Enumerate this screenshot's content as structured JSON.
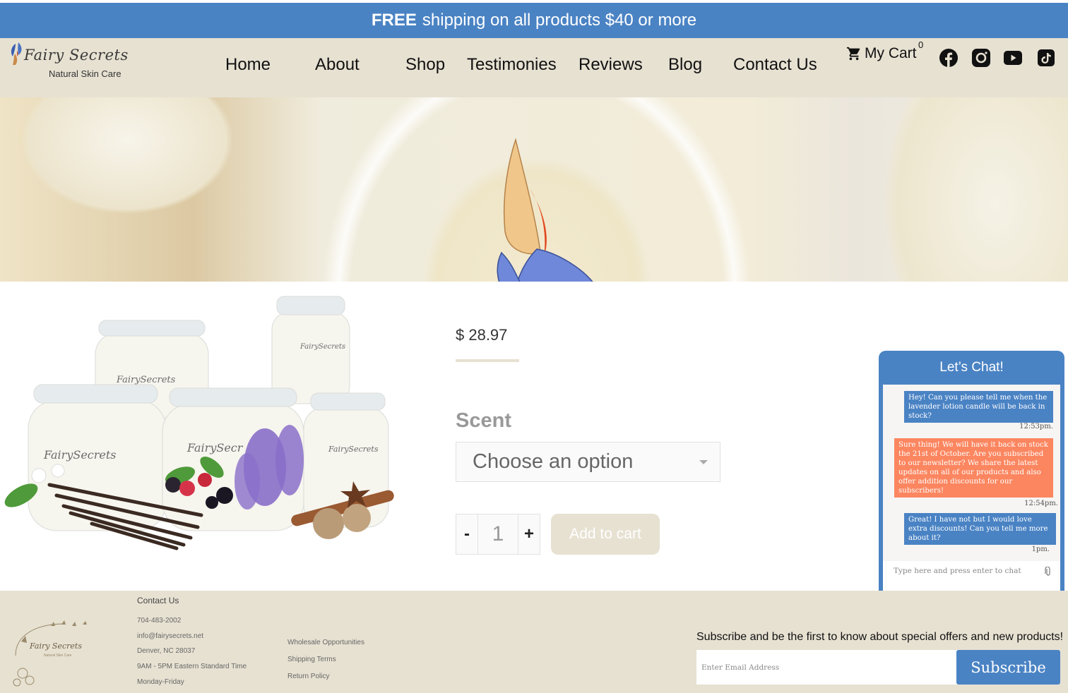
{
  "promo": {
    "bold": "FREE",
    "text": "shipping on all products $40 or more"
  },
  "header": {
    "logo_name": "Fairy Secrets",
    "logo_tagline": "Natural Skin Care",
    "nav": [
      "Home",
      "About",
      "Shop",
      "Testimonies",
      "Reviews",
      "Blog",
      "Contact Us"
    ],
    "cart_label": "My Cart",
    "cart_count": "0",
    "social": [
      "facebook",
      "instagram",
      "youtube",
      "tiktok"
    ]
  },
  "product": {
    "price": "$ 28.97",
    "scent_label": "Scent",
    "scent_select": "Choose an option",
    "quantity": "1",
    "minus": "-",
    "plus": "+",
    "add_to_cart": "Add to cart"
  },
  "chat": {
    "title": "Let’s Chat!",
    "messages": [
      {
        "from": "user",
        "text": "Hey! Can you please tell me when the lavender lotion candle will be back in stock?",
        "time": "12:53pm."
      },
      {
        "from": "agent",
        "text": "Sure thing! We will have it back on stock the 21st of October. Are you subscribed to our newsletter? We share the latest updates on all of our products and also offer addition discounts for our subscribers!",
        "time": "12:54pm."
      },
      {
        "from": "user",
        "text": "Great! I have not but I would love extra discounts! Can you tell me more about it?",
        "time": "1pm."
      }
    ],
    "input_placeholder": "Type here and press enter to chat"
  },
  "footer": {
    "contact_heading": "Contact Us",
    "contact_lines": [
      "704-483-2002",
      "info@fairysecrets.net",
      "Denver, NC 28037",
      "9AM - 5PM Eastern Standard Time",
      "Monday-Friday"
    ],
    "links": [
      "Wholesale Opportunities",
      "Shipping Terms",
      "Return Policy"
    ],
    "subscribe_text": "Subscribe and be the first to know about special offers and new products!",
    "email_placeholder": "Enter Email Address",
    "subscribe_button": "Subscribe"
  },
  "colors": {
    "brand_blue": "#4a83c4",
    "beige": "#e7e1d2",
    "agent_bubble": "#fb8660"
  }
}
